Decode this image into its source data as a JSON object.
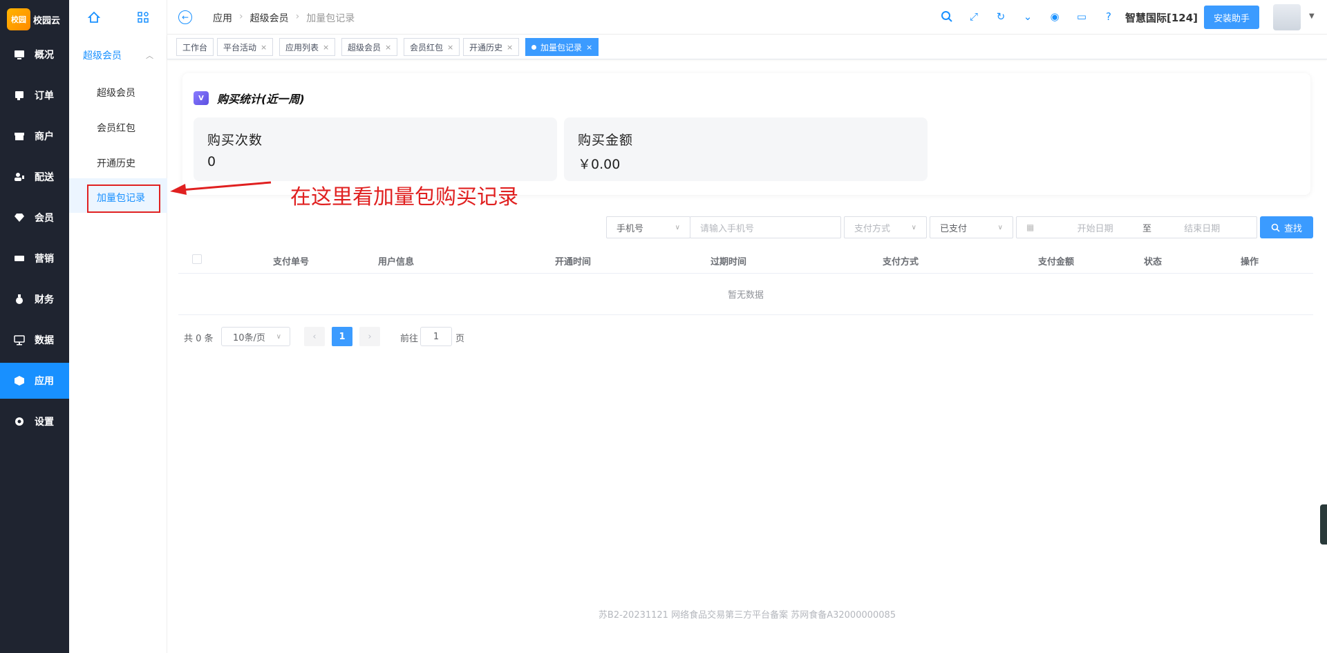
{
  "logo": {
    "mark": "校园",
    "name": "校园云"
  },
  "nav": [
    {
      "label": "概况",
      "icon": "dashboard-icon"
    },
    {
      "label": "订单",
      "icon": "order-icon"
    },
    {
      "label": "商户",
      "icon": "store-icon"
    },
    {
      "label": "配送",
      "icon": "delivery-icon"
    },
    {
      "label": "会员",
      "icon": "diamond-icon"
    },
    {
      "label": "营销",
      "icon": "ticket-icon"
    },
    {
      "label": "财务",
      "icon": "money-bag-icon"
    },
    {
      "label": "数据",
      "icon": "chart-monitor-icon"
    },
    {
      "label": "应用",
      "icon": "cube-icon",
      "active": true
    },
    {
      "label": "设置",
      "icon": "settings-icon"
    }
  ],
  "submenu": {
    "group": "超级会员",
    "items": [
      "超级会员",
      "会员红包",
      "开通历史",
      "加量包记录"
    ],
    "active": "加量包记录"
  },
  "header": {
    "breadcrumb": [
      "应用",
      "超级会员",
      "加量包记录"
    ],
    "tenant": "智慧国际[124]",
    "install_button": "安装助手"
  },
  "tabs": [
    {
      "label": "工作台",
      "closable": false
    },
    {
      "label": "平台活动",
      "closable": true
    },
    {
      "label": "应用列表",
      "closable": true
    },
    {
      "label": "超级会员",
      "closable": true
    },
    {
      "label": "会员红包",
      "closable": true
    },
    {
      "label": "开通历史",
      "closable": true
    },
    {
      "label": "加量包记录",
      "closable": true,
      "active": true
    }
  ],
  "tab_close": "×",
  "stats": {
    "title": "购买统计(近一周)",
    "badge": "V",
    "count_label": "购买次数",
    "count_value": "0",
    "amount_label": "购买金额",
    "amount_value": "￥0.00"
  },
  "annotation": "在这里看加量包购买记录",
  "filters": {
    "field_select": "手机号",
    "phone_placeholder": "请输入手机号",
    "pay_method_placeholder": "支付方式",
    "status_select": "已支付",
    "start_placeholder": "开始日期",
    "range_sep": "至",
    "end_placeholder": "结束日期",
    "search_button": "查找"
  },
  "table": {
    "columns": [
      "支付单号",
      "用户信息",
      "开通时间",
      "过期时间",
      "支付方式",
      "支付金额",
      "状态",
      "操作"
    ],
    "empty_text": "暂无数据"
  },
  "pagination": {
    "total": "共 0 条",
    "page_size": "10条/页",
    "current": "1",
    "goto_label": "前往",
    "goto_value": "1",
    "page_suffix": "页"
  },
  "footer": "苏B2-20231121  网络食品交易第三方平台备案 苏网食备A32000000085",
  "colors": {
    "primary": "#1890ff",
    "sidebar": "#1f2430",
    "annotation": "#e02020"
  }
}
